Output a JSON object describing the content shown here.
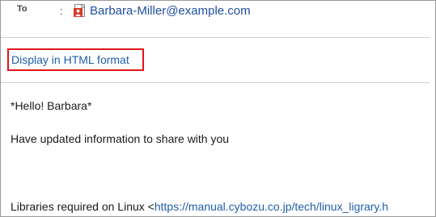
{
  "header": {
    "to_label": "To",
    "separator": ":",
    "recipient_email": "Barbara-Miller@example.com",
    "recipient_icon": "person-card-icon"
  },
  "actions": {
    "display_html_label": "Display in HTML format"
  },
  "message": {
    "greeting": "*Hello! Barbara*",
    "info_line": "Have updated information to share with you",
    "libraries_prefix": "Libraries required on Linux <",
    "libraries_link": "https://manual.cybozu.co.jp/tech/linux_ligrary.h"
  },
  "colors": {
    "link": "#1f5fa8",
    "highlight_border": "#e3141b",
    "divider": "#cfcfcf"
  }
}
